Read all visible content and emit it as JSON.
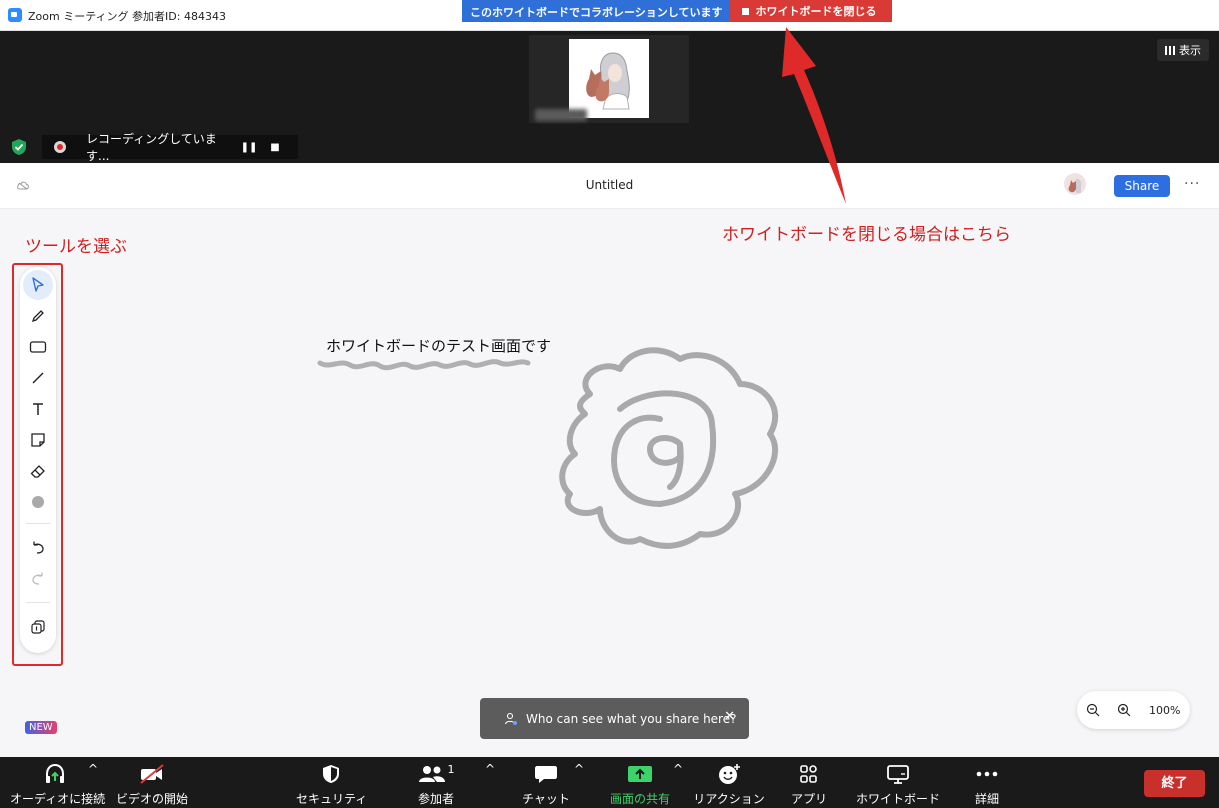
{
  "window": {
    "title": "Zoom ミーティング 参加者ID: 484343",
    "collab_info": "このホワイトボードでコラボレーションしています",
    "close_whiteboard": "ホワイトボードを閉じる"
  },
  "meeting": {
    "view_label": "表示",
    "recording_text": "レコーディングしています..."
  },
  "whiteboard": {
    "doc_title": "Untitled",
    "share_label": "Share",
    "canvas_text": "ホワイトボードのテスト画面です",
    "new_badge": "NEW",
    "toast_text": "Who can see what you share here?",
    "zoom_level": "100%",
    "tools": [
      "select-tool",
      "pen-tool",
      "rectangle-tool",
      "line-tool",
      "text-tool",
      "sticky-note-tool",
      "eraser-tool",
      "color-tool",
      "undo",
      "redo",
      "templates"
    ]
  },
  "annotations": {
    "tools_hint": "ツールを選ぶ",
    "close_hint": "ホワイトボードを閉じる場合はこちら"
  },
  "bottom_bar": {
    "audio": "オーディオに接続",
    "video": "ビデオの開始",
    "security": "セキュリティ",
    "participants": "参加者",
    "participants_count": "1",
    "chat": "チャット",
    "share_screen": "画面の共有",
    "reactions": "リアクション",
    "apps": "アプリ",
    "whiteboard": "ホワイトボード",
    "more": "詳細",
    "end": "終了"
  },
  "colors": {
    "accent_blue": "#2d6ee0",
    "close_red": "#d93a35",
    "annotation_red": "#d11f1f",
    "share_green": "#3ed26b"
  }
}
